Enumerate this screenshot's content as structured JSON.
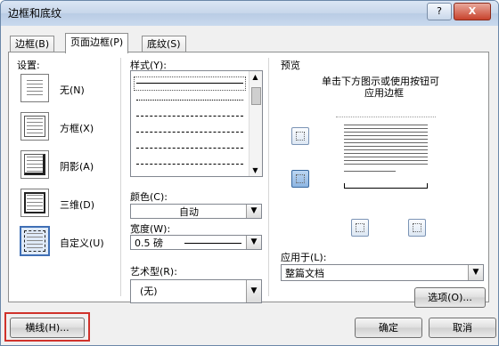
{
  "window": {
    "title": "边框和底纹",
    "help_label": "?",
    "close_label": "X"
  },
  "tabs": [
    {
      "label": "边框(B)"
    },
    {
      "label": "页面边框(P)"
    },
    {
      "label": "底纹(S)"
    }
  ],
  "setting": {
    "heading": "设置:",
    "options": [
      {
        "label": "无(N)",
        "icon": "setting-none-icon"
      },
      {
        "label": "方框(X)",
        "icon": "setting-box-icon"
      },
      {
        "label": "阴影(A)",
        "icon": "setting-shadow-icon"
      },
      {
        "label": "三维(D)",
        "icon": "setting-3d-icon"
      },
      {
        "label": "自定义(U)",
        "icon": "setting-custom-icon"
      }
    ]
  },
  "style": {
    "heading": "样式(Y):"
  },
  "color": {
    "label": "颜色(C):",
    "value": "自动"
  },
  "width": {
    "label": "宽度(W):",
    "value": "0.5 磅"
  },
  "art": {
    "label": "艺术型(R):",
    "value": "(无)"
  },
  "preview": {
    "heading": "预览",
    "hint_line1": "单击下方图示或使用按钮可",
    "hint_line2": "应用边框"
  },
  "apply_to": {
    "label": "应用于(L):",
    "value": "整篇文档"
  },
  "options_button": "选项(O)...",
  "horizontal_line_button": "横线(H)...",
  "ok_button": "确定",
  "cancel_button": "取消",
  "colors": {
    "highlight_outline": "#d0322b",
    "selected_border": "#3f6fb5"
  }
}
